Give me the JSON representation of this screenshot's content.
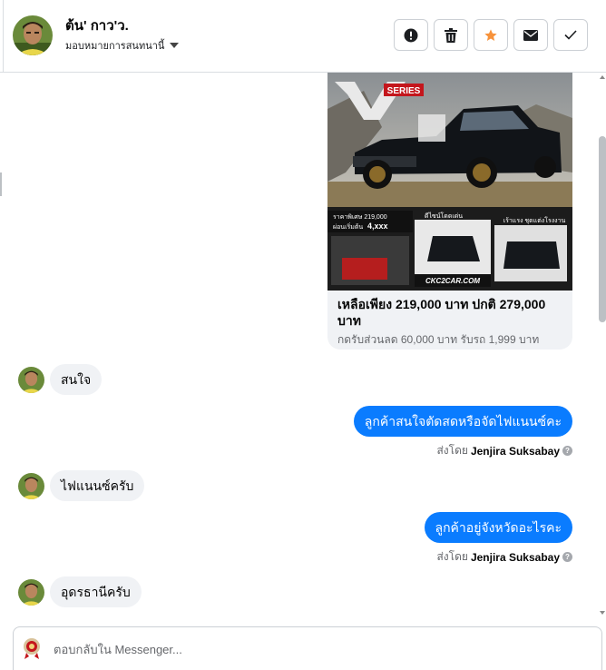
{
  "header": {
    "contact_name": "ต้น' กาว'ว.",
    "assign_label": "มอบหมายการสนทนานี้",
    "actions": [
      {
        "name": "spam",
        "icon": "exclamation-icon"
      },
      {
        "name": "delete",
        "icon": "trash-icon"
      },
      {
        "name": "star",
        "icon": "star-icon",
        "color": "#f7923b"
      },
      {
        "name": "mark-unread",
        "icon": "envelope-icon"
      },
      {
        "name": "done",
        "icon": "check-icon"
      }
    ]
  },
  "ad": {
    "badge": "SERIES",
    "price_tag_label": "ราคาพิเศษ 219,000",
    "installment_label": "ผ่อนเริ่มต้น",
    "installment_value": "4,xxx",
    "mid_caption": "ดีไซน์โดดเด่น",
    "right_caption": "เร้าแรง ชุดแต่งโรงงาน",
    "site": "CKC2CAR.COM",
    "title": "เหลือเพียง 219,000 บาท ปกติ 279,000 บาท",
    "subtitle": "กดรับส่วนลด 60,000 บาท รับรถ 1,999 บาท"
  },
  "messages": [
    {
      "direction": "in",
      "text": "สนใจ"
    },
    {
      "direction": "out",
      "text": "ลูกค้าสนใจตัดสดหรือจัดไฟแนนซ์คะ",
      "sent_by_label": "ส่งโดย",
      "sender": "Jenjira Suksabay"
    },
    {
      "direction": "in",
      "text": "ไฟแนนซ์ครับ"
    },
    {
      "direction": "out",
      "text": "ลูกค้าอยู่จังหวัดอะไรคะ",
      "sent_by_label": "ส่งโดย",
      "sender": "Jenjira Suksabay"
    },
    {
      "direction": "in",
      "text": "อุดรธานีครับ"
    }
  ],
  "composer": {
    "placeholder": "ตอบกลับใน Messenger..."
  },
  "colors": {
    "outgoing_bubble": "#0a7cff",
    "incoming_bubble": "#f0f2f5",
    "star": "#f7923b"
  }
}
